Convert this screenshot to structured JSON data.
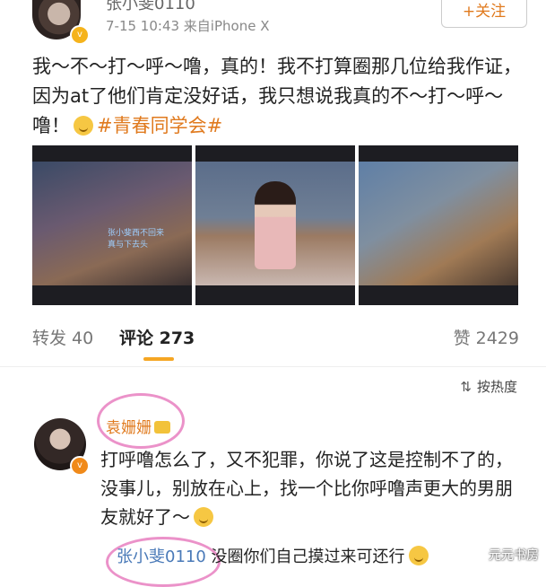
{
  "post": {
    "username": "张小斐0110",
    "meta": "7-15 10:43  来自iPhone X",
    "follow_label": "+关注",
    "text": "我～不～打～呼～噜，真的！我不打算圈那几位给我作证，因为at了他们肯定没好话，我只想说我真的不～打～呼～噜！",
    "hashtag": "#青春同学会#"
  },
  "thumbnails": [
    {
      "caption": "张小斐西不回来 真与下去头"
    },
    {
      "caption": ""
    },
    {
      "caption": ""
    }
  ],
  "stats": {
    "repost": "转发 40",
    "comments": "评论 273",
    "likes": "赞 2429",
    "sort_label": "按热度",
    "sort_icon": "sort-icon"
  },
  "comment": {
    "username": "袁姗姗",
    "text": "打呼噜怎么了，又不犯罪，你说了这是控制不了的，没事儿，别放在心上，找一个比你呼噜声更大的男朋友就好了～",
    "reply_user": "张小斐0110",
    "reply_text": "没圈你们自己摸过来可还行"
  },
  "watermark": "元元书房",
  "colors": {
    "accent": "#e07a1e",
    "link": "#4a7ab8",
    "circle": "#e87fc0"
  }
}
